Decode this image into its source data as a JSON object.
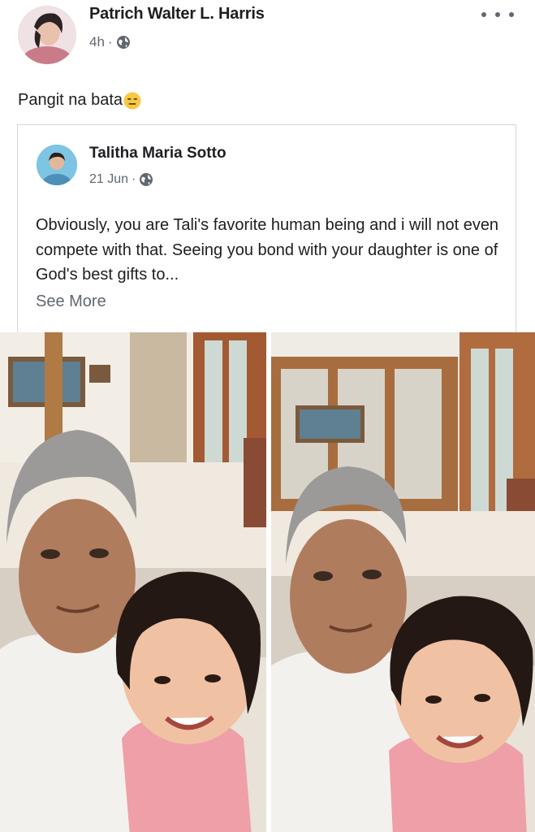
{
  "post": {
    "author": "Patrich Walter L. Harris",
    "time": "4h",
    "separator": "·",
    "caption": "Pangit na bata",
    "caption_emoji": "expressionless-emoji"
  },
  "shared_post": {
    "author": "Talitha Maria Sotto",
    "date": "21 Jun",
    "separator": "·",
    "text": "Obviously, you are Tali's favorite human being and i will not even compete with that. Seeing you bond with your daughter is one of God's best gifts to...",
    "see_more": "See More"
  },
  "photos": [
    {
      "name": "photo-father-daughter-selfie-1"
    },
    {
      "name": "photo-father-daughter-selfie-2"
    }
  ],
  "colors": {
    "text": "#1c1e21",
    "meta": "#606770",
    "border": "#d4d6da"
  }
}
